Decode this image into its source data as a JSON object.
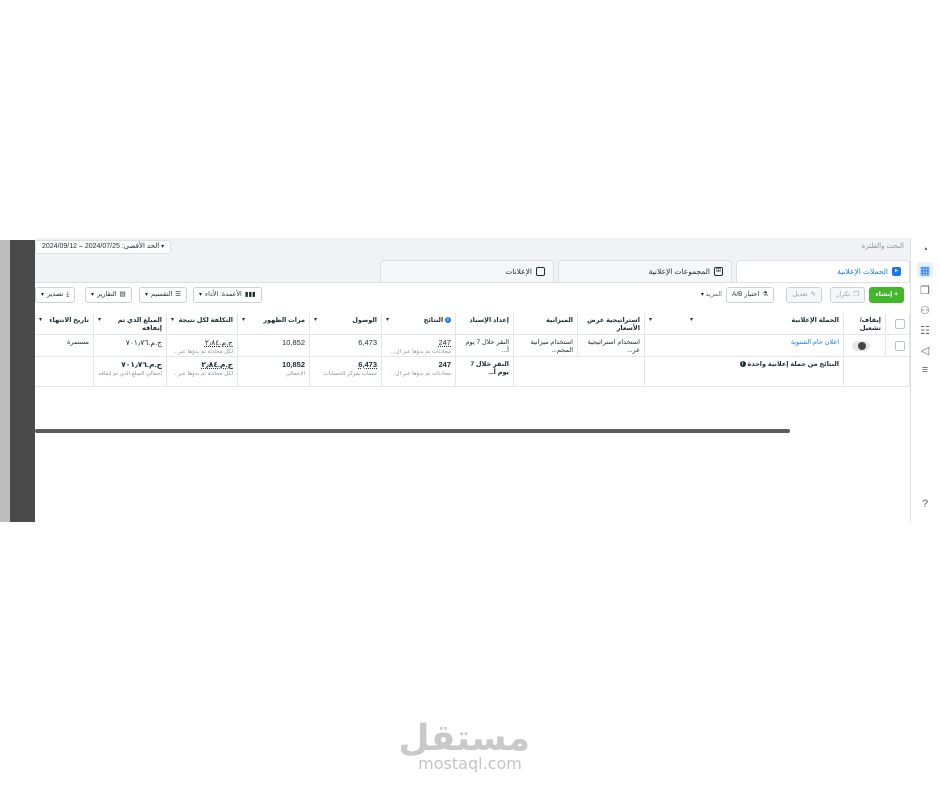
{
  "topbar": {
    "date_range": "الحد الأقصى: 2024/07/25 – 2024/09/12",
    "search_placeholder": "البحث والفلترة"
  },
  "tabs": [
    {
      "label": "الحملات الإعلانية",
      "active": true
    },
    {
      "label": "المجموعات الإعلانية",
      "active": false
    },
    {
      "label": "الإعلانات",
      "active": false
    }
  ],
  "toolbar": {
    "create": "+ إنشاء",
    "duplicate": "تكرار",
    "edit": "تعديل",
    "ab_test": "اختبار A/B",
    "more": "المزيد",
    "columns": "الأعمدة: الأداء",
    "breakdown": "التقسيم",
    "reports": "التقارير",
    "export": "تصدير"
  },
  "table": {
    "headers": {
      "toggle": "إيقاف/ تشغيل",
      "campaign": "الحملة الإعلانية",
      "bid_strategy": "استراتيجية عرض الأسعار",
      "budget": "الميزانية",
      "attribution": "إعداد الإسناد",
      "results": "النتائج",
      "reach": "الوصول",
      "impressions": "مرات الظهور",
      "cost_per_result": "التكلفة لكل نتيجة",
      "amount_spent": "المبلغ الذي تم إنفاقه",
      "end_date": "تاريخ الانتهاء"
    },
    "row": {
      "campaign": "اعلان جام الشتوية",
      "bid_strategy": "استخدام استراتيجية عر...",
      "budget": "استخدام ميزانية المجم...",
      "attribution": "النقر خلال 7 يوم أ...",
      "results": "247",
      "results_sub": "محادثات تم بدؤها عبر ال...",
      "reach": "6,473",
      "impressions": "10,852",
      "cost_per_result": "ج.م.‏٢٫٨٤",
      "cost_per_result_sub": "لكل محادثة تم بدؤها عبر...",
      "amount_spent": "ج.م.‏٧٠١٫٧٦",
      "end_date": "مستمرة"
    },
    "summary": {
      "campaign": "النتائج من حملة إعلانية واحدة",
      "attribution": "النقر خلال 7 يوم أ...",
      "results": "247",
      "results_sub": "محادثات تم بدؤها عبر ال...",
      "reach": "6,473",
      "reach_sub": "حساب بمركز الحسابات",
      "impressions": "10,852",
      "impressions_sub": "الإجمالي",
      "cost_per_result": "ج.م.‏٢٫٨٤",
      "cost_per_result_sub": "لكل محادثة تم بدؤها عبر...",
      "amount_spent": "ج.م.‏٧٠١٫٧٦",
      "amount_spent_sub": "إجمالي المبلغ الذي تم إنفاقه"
    }
  },
  "watermark": {
    "logo": "مستقل",
    "url": "mostaql.com"
  },
  "colors": {
    "accent": "#1877f2",
    "create_button": "#42b72a",
    "canvas": "#f0f2f5"
  }
}
